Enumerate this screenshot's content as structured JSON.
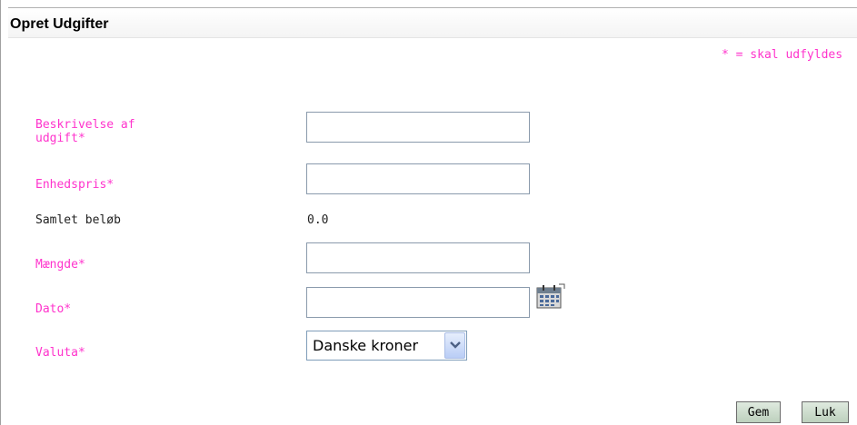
{
  "title": "Opret Udgifter",
  "required_note": "* = skal udfyldes",
  "fields": {
    "description": {
      "label": "Beskrivelse af\nudgift*",
      "value": ""
    },
    "unit_price": {
      "label": "Enhedspris*",
      "value": ""
    },
    "total": {
      "label": "Samlet beløb",
      "value": "0.0"
    },
    "quantity": {
      "label": "Mængde*",
      "value": ""
    },
    "date": {
      "label": "Dato*",
      "value": ""
    },
    "currency": {
      "label": "Valuta*",
      "selected": "Danske kroner"
    }
  },
  "icons": {
    "calendar": "calendar-icon",
    "dropdown": "chevron-down-icon"
  },
  "buttons": {
    "save": "Gem",
    "close": "Luk"
  },
  "colors": {
    "required_label": "#ff33cc",
    "button_bg": "#c8d8c8"
  }
}
